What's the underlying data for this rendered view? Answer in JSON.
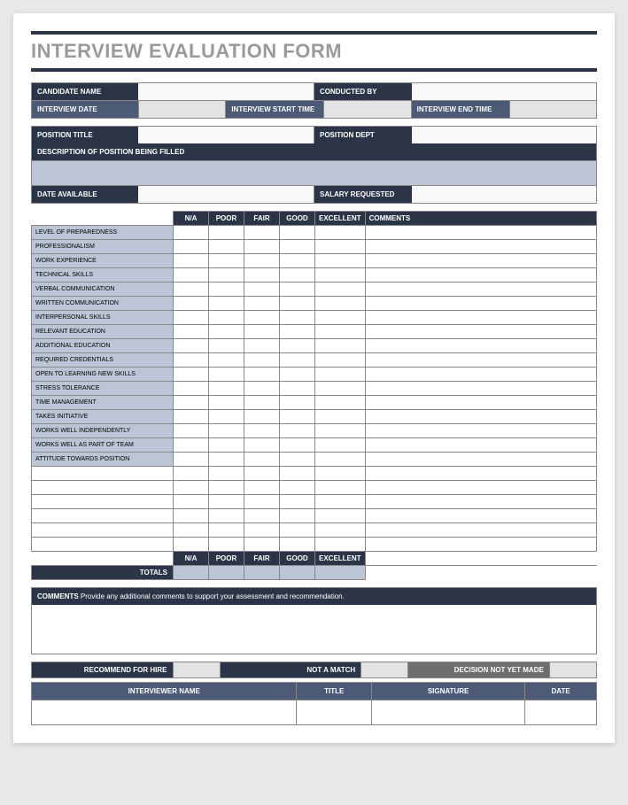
{
  "title": "INTERVIEW EVALUATION FORM",
  "info": {
    "candidate_name": "CANDIDATE NAME",
    "conducted_by": "CONDUCTED BY",
    "interview_date": "INTERVIEW DATE",
    "start_time": "INTERVIEW START TIME",
    "end_time": "INTERVIEW END TIME",
    "position_title": "POSITION TITLE",
    "position_dept": "POSITION DEPT",
    "description": "DESCRIPTION OF POSITION BEING FILLED",
    "date_available": "DATE AVAILABLE",
    "salary_requested": "SALARY REQUESTED"
  },
  "rating_headers": [
    "N/A",
    "POOR",
    "FAIR",
    "GOOD",
    "EXCELLENT",
    "COMMENTS"
  ],
  "criteria": [
    "LEVEL OF PREPAREDNESS",
    "PROFESSIONALISM",
    "WORK EXPERIENCE",
    "TECHNICAL SKILLS",
    "VERBAL COMMUNICATION",
    "WRITTEN COMMUNICATION",
    "INTERPERSONAL SKILLS",
    "RELEVANT EDUCATION",
    "ADDITIONAL EDUCATION",
    "REQUIRED CREDENTIALS",
    "OPEN TO LEARNING NEW SKILLS",
    "STRESS TOLERANCE",
    "TIME MANAGEMENT",
    "TAKES INITIATIVE",
    "WORKS WELL INDEPENDENTLY",
    "WORKS WELL AS PART OF TEAM",
    "ATTITUDE TOWARDS POSITION"
  ],
  "blank_rows": 6,
  "totals_label": "TOTALS",
  "comments": {
    "label": "COMMENTS",
    "hint": "Provide any additional comments to support your assessment and recommendation."
  },
  "recommend": {
    "hire": "RECOMMEND FOR HIRE",
    "not_match": "NOT A MATCH",
    "undecided": "DECISION NOT YET MADE"
  },
  "signature_headers": [
    "INTERVIEWER NAME",
    "TITLE",
    "SIGNATURE",
    "DATE"
  ]
}
